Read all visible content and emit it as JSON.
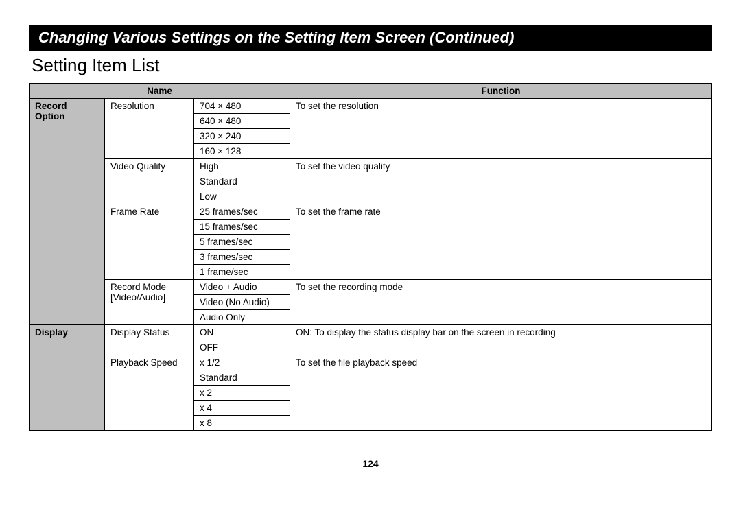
{
  "banner_title": "Changing Various Settings on the Setting Item Screen (Continued)",
  "subtitle": "Setting Item List",
  "headers": {
    "name": "Name",
    "function": "Function"
  },
  "categories": {
    "record_option": "Record Option",
    "display": "Display"
  },
  "record_option": {
    "resolution": {
      "label": "Resolution",
      "options": [
        "704 × 480",
        "640 × 480",
        "320 × 240",
        "160 × 128"
      ],
      "function": "To set the resolution"
    },
    "video_quality": {
      "label": "Video Quality",
      "options": [
        "High",
        "Standard",
        "Low"
      ],
      "function": "To set the video quality"
    },
    "frame_rate": {
      "label": "Frame Rate",
      "options": [
        "25 frames/sec",
        "15 frames/sec",
        "5 frames/sec",
        "3 frames/sec",
        "1 frame/sec"
      ],
      "function": "To set the frame rate"
    },
    "record_mode": {
      "label_line1": "Record Mode",
      "label_line2": "[Video/Audio]",
      "options": [
        "Video + Audio",
        "Video (No Audio)",
        "Audio Only"
      ],
      "function": "To set the recording mode"
    }
  },
  "display": {
    "display_status": {
      "label": "Display Status",
      "options": [
        "ON",
        "OFF"
      ],
      "function": "ON: To display the status display bar on the screen in recording"
    },
    "playback_speed": {
      "label": "Playback Speed",
      "options": [
        "x 1/2",
        "Standard",
        "x 2",
        "x 4",
        "x 8"
      ],
      "function": "To set the file playback speed"
    }
  },
  "page_number": "124"
}
